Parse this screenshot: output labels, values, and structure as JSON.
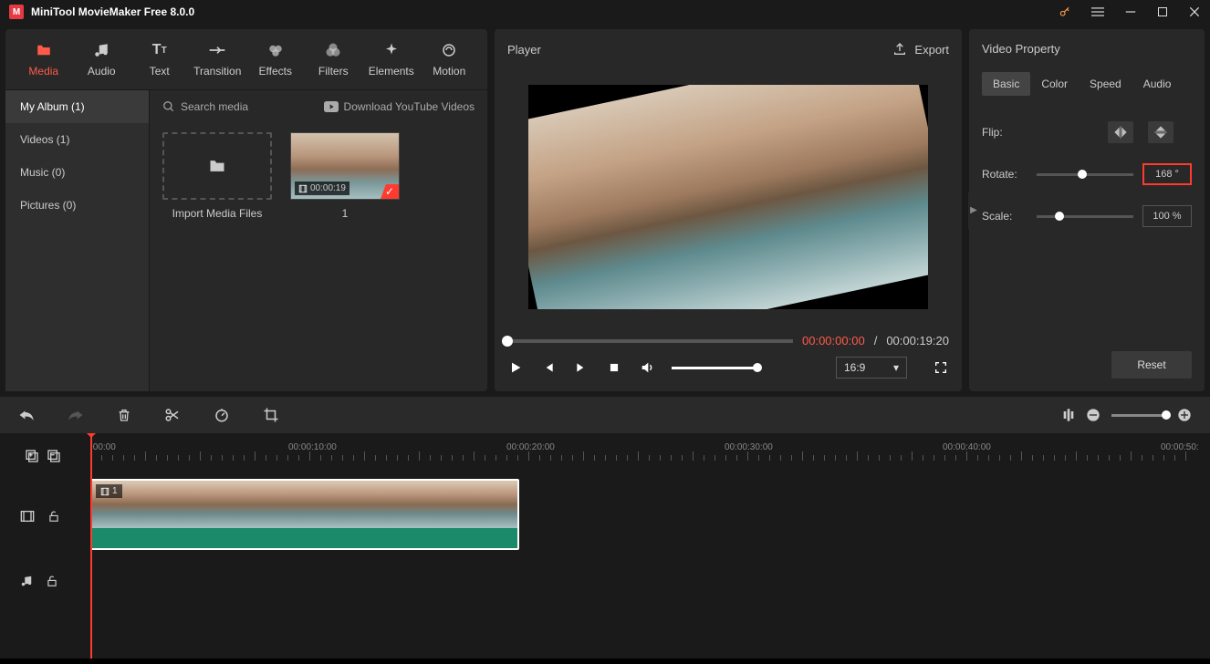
{
  "titlebar": {
    "title": "MiniTool MovieMaker Free 8.0.0"
  },
  "tabs": [
    {
      "label": "Media",
      "active": true
    },
    {
      "label": "Audio"
    },
    {
      "label": "Text"
    },
    {
      "label": "Transition"
    },
    {
      "label": "Effects"
    },
    {
      "label": "Filters"
    },
    {
      "label": "Elements"
    },
    {
      "label": "Motion"
    }
  ],
  "sidebar": [
    {
      "label": "My Album (1)",
      "active": true
    },
    {
      "label": "Videos (1)"
    },
    {
      "label": "Music (0)"
    },
    {
      "label": "Pictures (0)"
    }
  ],
  "media": {
    "search_placeholder": "Search media",
    "download_label": "Download YouTube Videos",
    "import_label": "Import Media Files",
    "clip_duration": "00:00:19",
    "clip_index": "1"
  },
  "player": {
    "title": "Player",
    "export": "Export",
    "time_current": "00:00:00:00",
    "time_duration": "00:00:19:20",
    "aspect": "16:9"
  },
  "props": {
    "title": "Video Property",
    "tabs": [
      "Basic",
      "Color",
      "Speed",
      "Audio"
    ],
    "flip_label": "Flip:",
    "rotate_label": "Rotate:",
    "rotate_value": "168 °",
    "scale_label": "Scale:",
    "scale_value": "100 %",
    "reset": "Reset"
  },
  "timeline": {
    "marks": [
      ":00:00",
      "00:00:10:00",
      "00:00:20:00",
      "00:00:30:00",
      "00:00:40:00",
      "00:00:50:"
    ],
    "clip_index": "1"
  }
}
